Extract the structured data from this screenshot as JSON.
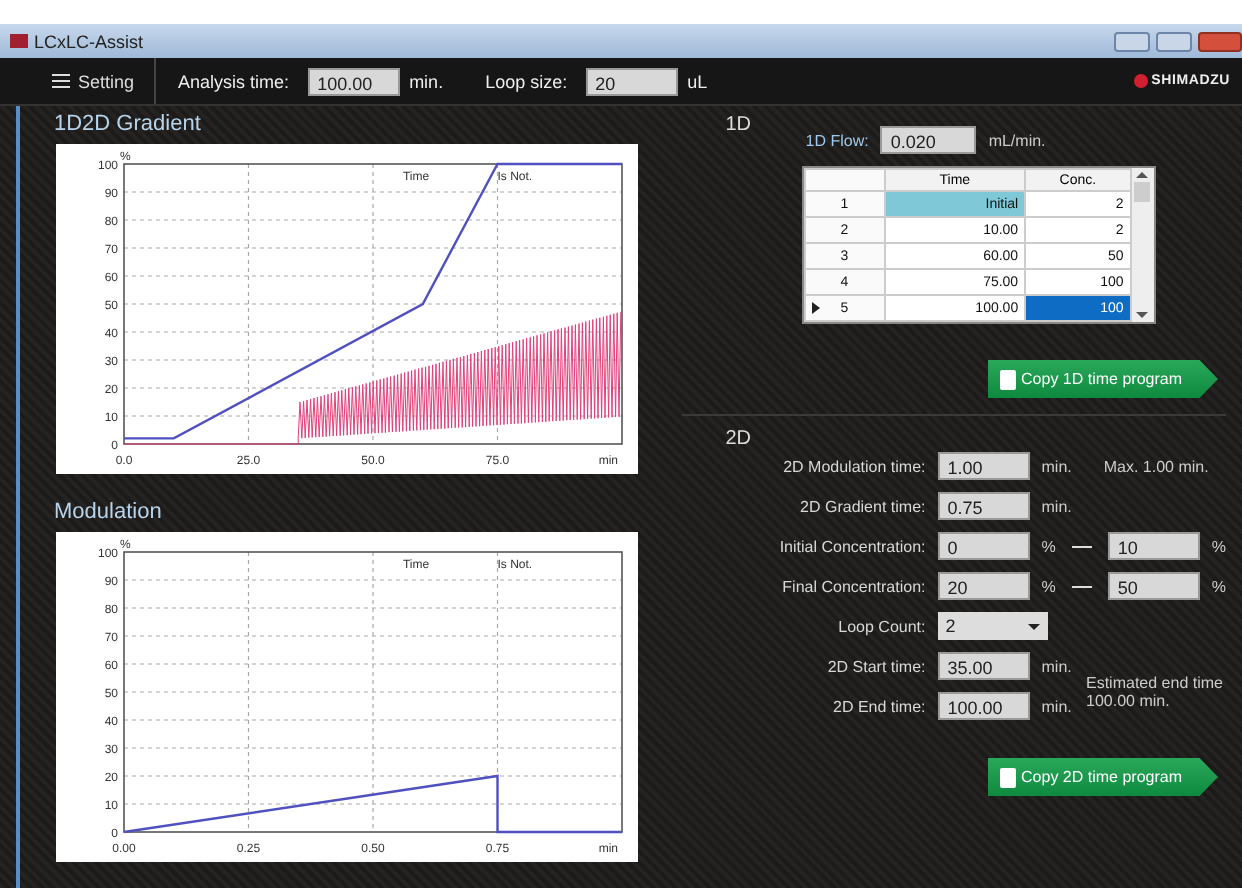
{
  "window": {
    "title": "LCxLC-Assist"
  },
  "toolbar": {
    "menu_label": "Setting",
    "fields": [
      {
        "label": "Analysis time:",
        "value": "100.00",
        "unit": "min."
      },
      {
        "label": "Loop size:",
        "value": "20",
        "unit": "uL"
      }
    ],
    "brand": "SHIMADZU"
  },
  "panels": [
    {
      "title": "1D2D Gradient",
      "chart_data": {
        "type": "line",
        "xlabel": "min",
        "ylabel": "%",
        "xlim": [
          0,
          100
        ],
        "ylim": [
          0,
          100
        ],
        "xticks": [
          {
            "value": 0,
            "label": "0.0"
          },
          {
            "value": 25,
            "label": "25.0"
          },
          {
            "value": 50,
            "label": "50.0"
          },
          {
            "value": 75,
            "label": "75.0"
          }
        ],
        "yticks": [
          0,
          10,
          20,
          30,
          40,
          50,
          60,
          70,
          80,
          90,
          100
        ],
        "annotations": [
          "Time",
          "Is Not."
        ],
        "grid": true,
        "series": [
          {
            "color": "#5050c0",
            "x": [
              0,
              10,
              60,
              75,
              100
            ],
            "values": [
              2,
              2,
              50,
              100,
              100
            ]
          }
        ]
      },
      "modulation_wave": true
    },
    {
      "title": "Modulation",
      "chart_data": {
        "type": "line",
        "xlabel": "min",
        "ylabel": "%",
        "xlim": [
          0,
          1
        ],
        "ylim": [
          0,
          100
        ],
        "xticks": [
          {
            "value": 0,
            "label": "0.00"
          },
          {
            "value": 0.25,
            "label": "0.25"
          },
          {
            "value": 0.5,
            "label": "0.50"
          },
          {
            "value": 0.75,
            "label": "0.75"
          }
        ],
        "yticks": [
          0,
          10,
          20,
          30,
          40,
          50,
          60,
          70,
          80,
          90,
          100
        ],
        "annotations": [
          "Time",
          "Is Not."
        ],
        "grid": true,
        "series": [
          {
            "color": "#5050c0",
            "x": [
              0,
              0.75,
              0.75,
              1
            ],
            "values": [
              0,
              20,
              0,
              0
            ]
          }
        ]
      },
      "modulation_wave": false
    }
  ],
  "section_1d": {
    "title": "1D",
    "flow_label": "1D Flow:",
    "flow_value": "0.020",
    "flow_unit": "mL/min.",
    "columns": [
      "Time",
      "Conc."
    ],
    "rows": [
      {
        "number": "1",
        "time": "Initial",
        "conc": "2",
        "time_locked": true,
        "current": false,
        "conc_selected": false
      },
      {
        "number": "2",
        "time": "10.00",
        "conc": "2",
        "time_locked": false,
        "current": false,
        "conc_selected": false
      },
      {
        "number": "3",
        "time": "60.00",
        "conc": "50",
        "time_locked": false,
        "current": false,
        "conc_selected": false
      },
      {
        "number": "4",
        "time": "75.00",
        "conc": "100",
        "time_locked": false,
        "current": false,
        "conc_selected": false
      },
      {
        "number": "5",
        "time": "100.00",
        "conc": "100",
        "time_locked": false,
        "current": true,
        "conc_selected": true
      }
    ],
    "button": "Copy 1D time program"
  },
  "section_2d": {
    "title": "2D",
    "rows": [
      {
        "kind": "field",
        "label": "2D Modulation time:",
        "value": "1.00",
        "unit": "min.",
        "note": "Max. 1.00 min."
      },
      {
        "kind": "field",
        "label": "2D Gradient time:",
        "value": "0.75",
        "unit": "min."
      },
      {
        "kind": "range",
        "label": "Initial Concentration:",
        "value": "0",
        "unit": "%",
        "to_value": "10",
        "to_unit": "%"
      },
      {
        "kind": "range",
        "label": "Final Concentration:",
        "value": "20",
        "unit": "%",
        "to_value": "50",
        "to_unit": "%"
      },
      {
        "kind": "dropdown",
        "label": "Loop Count:",
        "value": "2"
      },
      {
        "kind": "field",
        "label": "2D Start time:",
        "value": "35.00",
        "unit": "min."
      },
      {
        "kind": "field",
        "label": "2D End time:",
        "value": "100.00",
        "unit": "min."
      }
    ],
    "estimate": "Estimated end time 100.00 min.",
    "button": "Copy 2D time program"
  }
}
